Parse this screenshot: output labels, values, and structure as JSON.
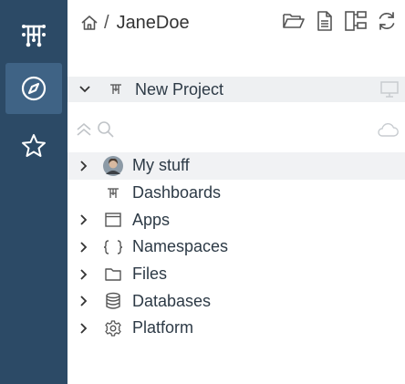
{
  "breadcrumb": {
    "home_icon": "home-icon",
    "separator": "/",
    "user": "JaneDoe"
  },
  "toolbar": {
    "icons": [
      "folder-open-icon",
      "document-icon",
      "hierarchy-icon",
      "refresh-icon"
    ]
  },
  "sidebar": {
    "items": [
      "app-logo-icon",
      "compass-icon",
      "star-icon"
    ],
    "active": "compass-icon"
  },
  "project": {
    "label": "New Project",
    "right_icon": "monitor-icon"
  },
  "search": {
    "placeholder": "",
    "right_icon": "cloud-icon"
  },
  "tree": {
    "items": [
      {
        "label": "My stuff",
        "icon": "avatar",
        "expandable": true,
        "selected": true
      },
      {
        "label": "Dashboards",
        "icon": "dashboards-icon",
        "expandable": false
      },
      {
        "label": "Apps",
        "icon": "window-icon",
        "expandable": true
      },
      {
        "label": "Namespaces",
        "icon": "braces-icon",
        "expandable": true
      },
      {
        "label": "Files",
        "icon": "folder-icon",
        "expandable": true
      },
      {
        "label": "Databases",
        "icon": "database-icon",
        "expandable": true
      },
      {
        "label": "Platform",
        "icon": "gear-icon",
        "expandable": true
      }
    ]
  },
  "colors": {
    "sidebar": "#2c4a66",
    "sidebar_active": "#3f6385",
    "row_highlight": "#eef0f2"
  }
}
